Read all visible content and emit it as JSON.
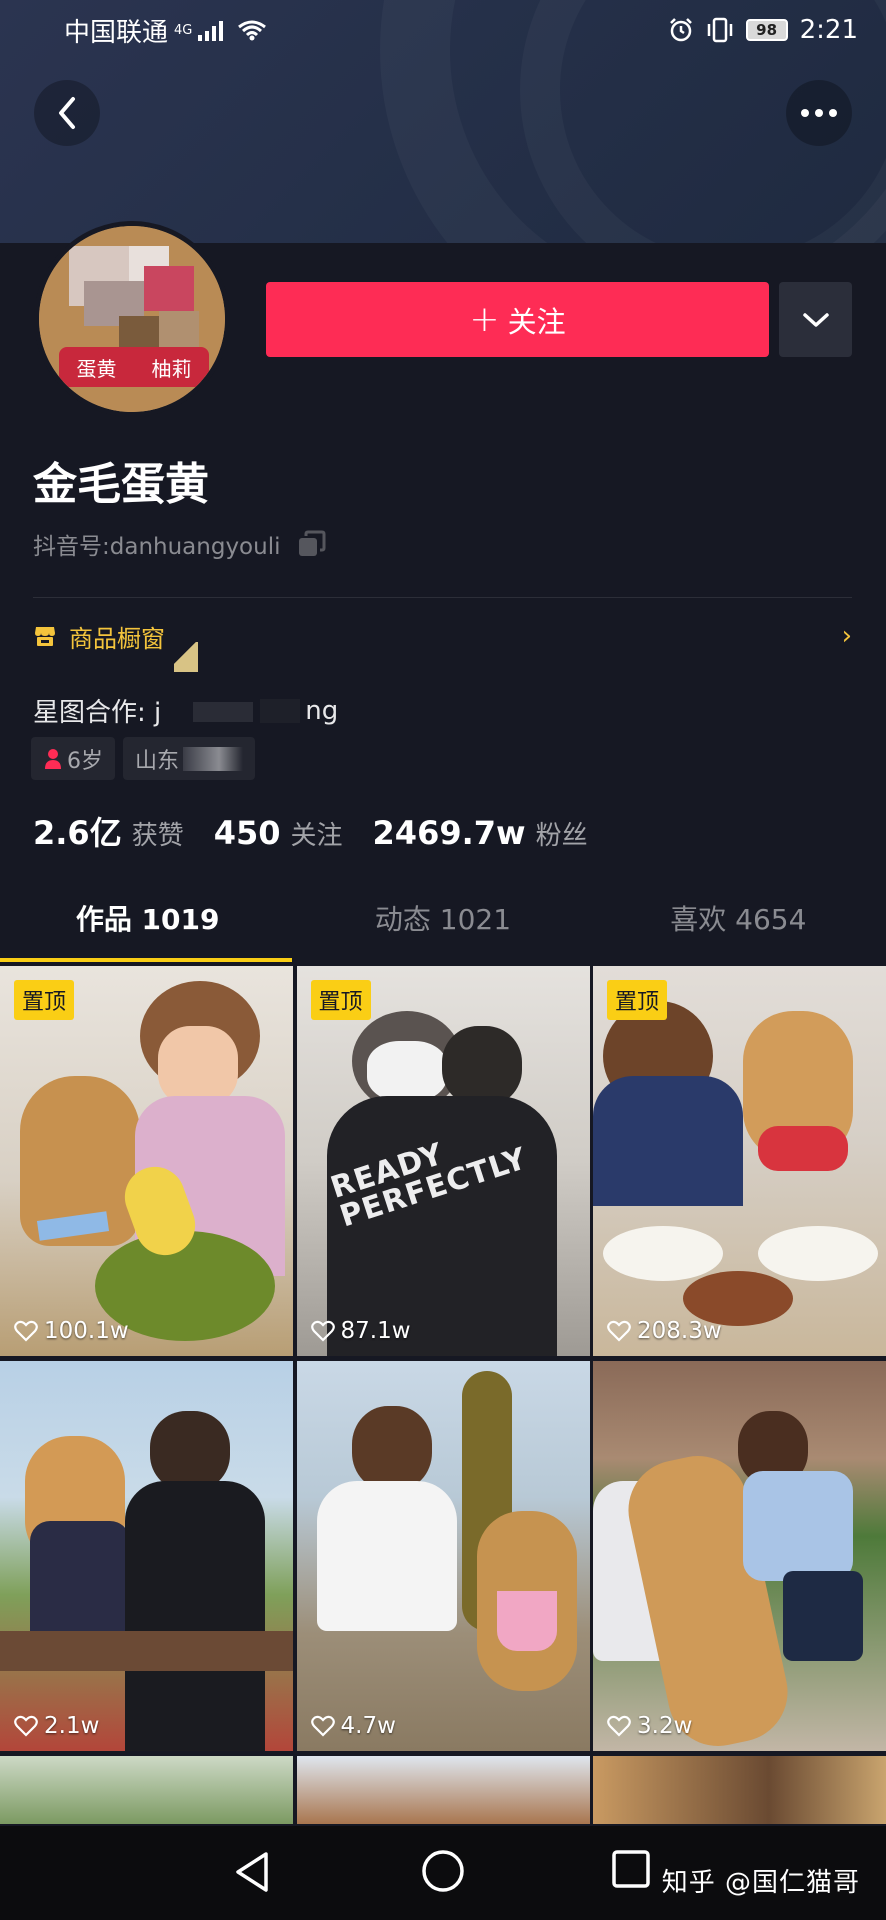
{
  "status_bar": {
    "carrier": "中国联通",
    "network": "4G",
    "battery": "98",
    "time": "2:21"
  },
  "profile": {
    "follow_label": "关注",
    "nickname": "金毛蛋黄",
    "douyin_id_label": "抖音号:",
    "douyin_id": "danhuangyouli",
    "avatar_scarf_left": "蛋黄",
    "avatar_scarf_right": "柚莉",
    "shop_label": "商品橱窗",
    "xingtu_prefix": "星图合作: j",
    "xingtu_suffix": "ng",
    "tags": [
      "6岁",
      "山东"
    ]
  },
  "stats": [
    {
      "num": "2.6亿",
      "label": "获赞"
    },
    {
      "num": "450",
      "label": "关注"
    },
    {
      "num": "2469.7w",
      "label": "粉丝"
    }
  ],
  "tabs": [
    {
      "label": "作品 1019"
    },
    {
      "label": "动态 1021"
    },
    {
      "label": "喜欢 4654"
    }
  ],
  "videos": [
    {
      "pinned": "置顶",
      "likes": "100.1w",
      "overlay": ""
    },
    {
      "pinned": "置顶",
      "likes": "87.1w",
      "overlay": "READY PERFECTLY"
    },
    {
      "pinned": "置顶",
      "likes": "208.3w",
      "overlay": ""
    },
    {
      "pinned": "",
      "likes": "2.1w",
      "overlay": ""
    },
    {
      "pinned": "",
      "likes": "4.7w",
      "overlay": ""
    },
    {
      "pinned": "",
      "likes": "3.2w",
      "overlay": ""
    }
  ],
  "watermark": "知乎 @国仁猫哥",
  "colors": {
    "background": "#161823",
    "accent_red": "#fe2c55",
    "accent_yellow": "#face15",
    "shop_gold": "#f4c43c"
  }
}
